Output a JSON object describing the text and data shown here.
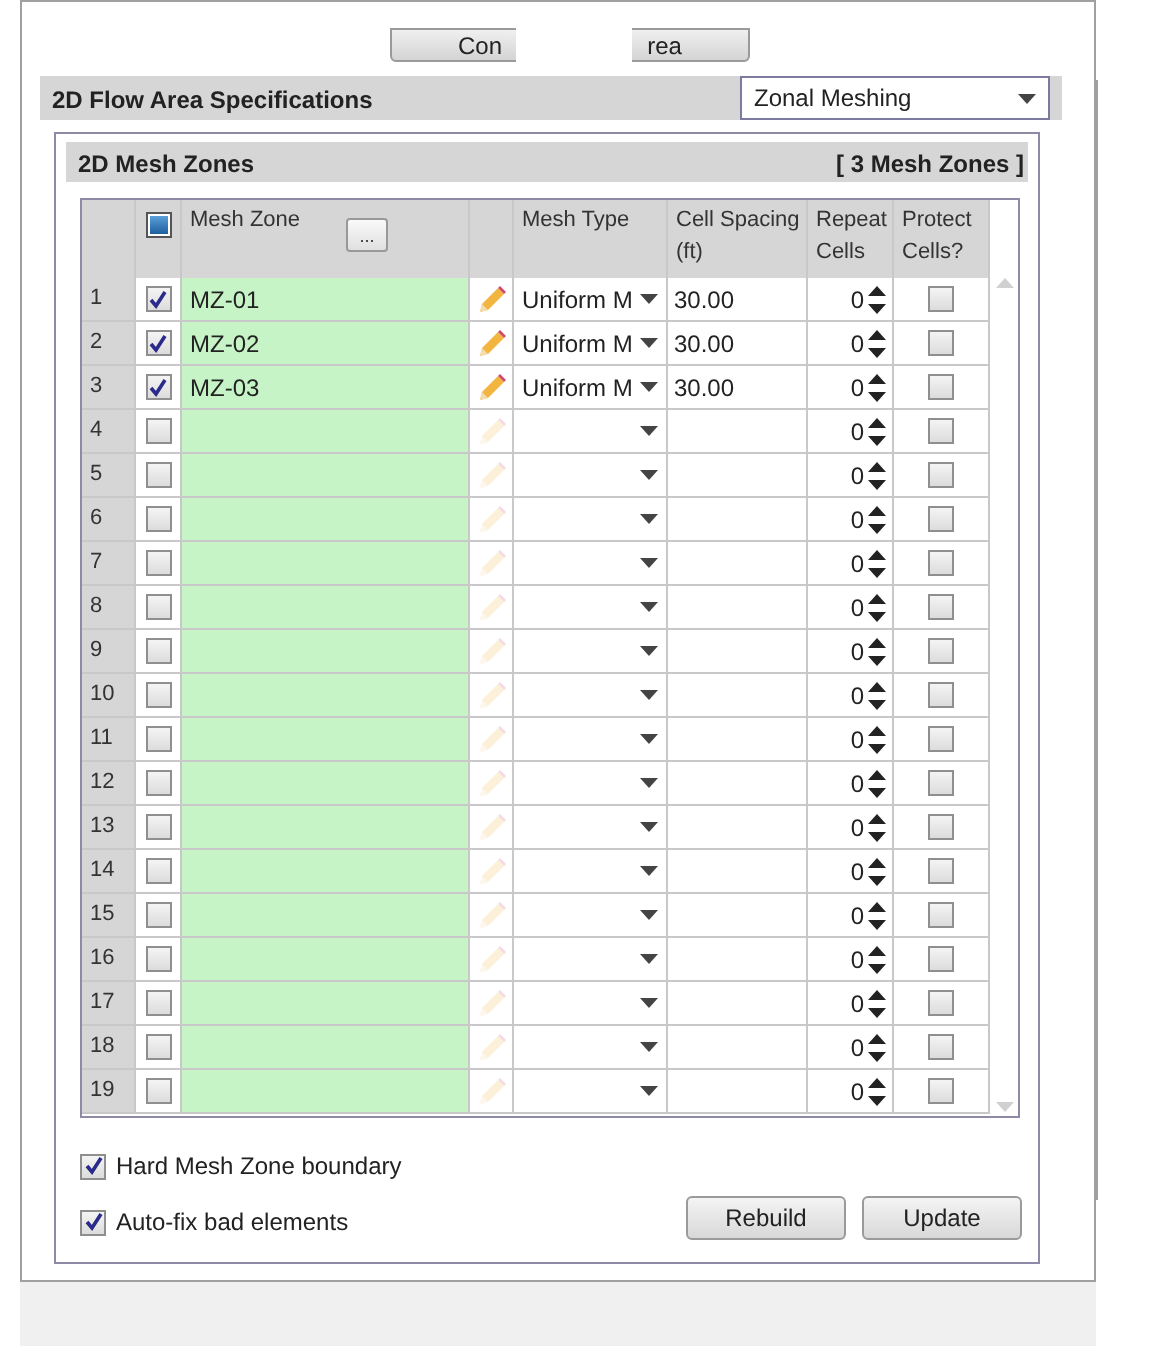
{
  "top_button": {
    "label_parts": [
      "Con",
      "rea"
    ]
  },
  "specs_bar": {
    "title": "2D Flow Area Specifications",
    "mode_dropdown": {
      "value": "Zonal Meshing"
    }
  },
  "mesh_zones": {
    "title": "2D Mesh Zones",
    "count": "[ 3 Mesh Zones ]",
    "select_all": {
      "indeterminate": true
    },
    "columns": [
      {
        "label": "Mesh Zone",
        "kind": "zone"
      },
      {
        "label": "Mesh Type",
        "kind": "type"
      },
      {
        "label": "Cell Spacing (ft)",
        "kind": "spacing"
      },
      {
        "label": "Repeat Cells",
        "kind": "repeat"
      },
      {
        "label": "Protect Cells?",
        "kind": "protect"
      }
    ],
    "browse_button": "...",
    "rows": [
      {
        "num": "1",
        "checked": true,
        "zone": "MZ-01",
        "mesh_type": "Uniform M",
        "spacing": "30.00",
        "repeat": "0",
        "protect": false
      },
      {
        "num": "2",
        "checked": true,
        "zone": "MZ-02",
        "mesh_type": "Uniform M",
        "spacing": "30.00",
        "repeat": "0",
        "protect": false
      },
      {
        "num": "3",
        "checked": true,
        "zone": "MZ-03",
        "mesh_type": "Uniform M",
        "spacing": "30.00",
        "repeat": "0",
        "protect": false
      },
      {
        "num": "4",
        "checked": false,
        "repeat": "0",
        "protect": false
      },
      {
        "num": "5",
        "checked": false,
        "repeat": "0",
        "protect": false
      },
      {
        "num": "6",
        "checked": false,
        "repeat": "0",
        "protect": false
      },
      {
        "num": "7",
        "checked": false,
        "repeat": "0",
        "protect": false
      },
      {
        "num": "8",
        "checked": false,
        "repeat": "0",
        "protect": false
      },
      {
        "num": "9",
        "checked": false,
        "repeat": "0",
        "protect": false
      },
      {
        "num": "10",
        "checked": false,
        "repeat": "0",
        "protect": false
      },
      {
        "num": "11",
        "checked": false,
        "repeat": "0",
        "protect": false
      },
      {
        "num": "12",
        "checked": false,
        "repeat": "0",
        "protect": false
      },
      {
        "num": "13",
        "checked": false,
        "repeat": "0",
        "protect": false
      },
      {
        "num": "14",
        "checked": false,
        "repeat": "0",
        "protect": false
      },
      {
        "num": "15",
        "checked": false,
        "repeat": "0",
        "protect": false
      },
      {
        "num": "16",
        "checked": false,
        "repeat": "0",
        "protect": false
      },
      {
        "num": "17",
        "checked": false,
        "repeat": "0",
        "protect": false
      },
      {
        "num": "18",
        "checked": false,
        "repeat": "0",
        "protect": false
      },
      {
        "num": "19",
        "checked": false,
        "repeat": "0",
        "protect": false
      }
    ]
  },
  "options": [
    {
      "label": "Hard Mesh Zone boundary",
      "checked": true
    },
    {
      "label": "Auto-fix bad elements",
      "checked": true
    }
  ],
  "buttons": [
    "Rebuild",
    "Update"
  ]
}
